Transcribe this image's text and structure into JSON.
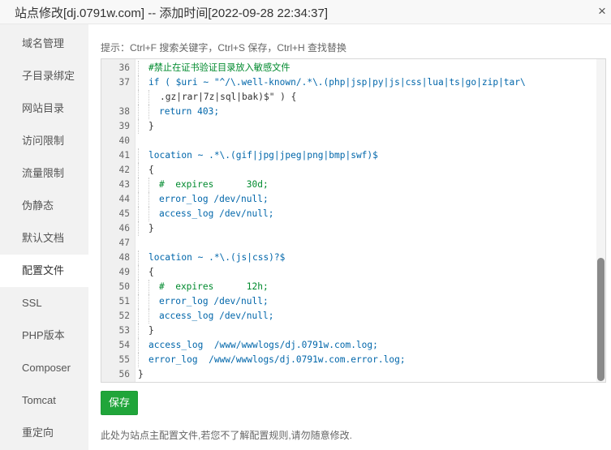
{
  "window": {
    "title": "站点修改[dj.0791w.com] -- 添加时间[2022-09-28 22:34:37]",
    "close_icon": "×"
  },
  "sidebar": {
    "items": [
      {
        "label": "域名管理"
      },
      {
        "label": "子目录绑定"
      },
      {
        "label": "网站目录"
      },
      {
        "label": "访问限制"
      },
      {
        "label": "流量限制"
      },
      {
        "label": "伪静态"
      },
      {
        "label": "默认文档"
      },
      {
        "label": "配置文件",
        "active": true
      },
      {
        "label": "SSL"
      },
      {
        "label": "PHP版本"
      },
      {
        "label": "Composer"
      },
      {
        "label": "Tomcat"
      },
      {
        "label": "重定向"
      }
    ]
  },
  "editor": {
    "hint": "提示：Ctrl+F 搜索关键字，Ctrl+S 保存，Ctrl+H 查找替换",
    "lines": [
      {
        "num": "36",
        "text": "#禁止在证书验证目录放入敏感文件"
      },
      {
        "num": "37",
        "text": "if ( $uri ~ \"^/\\.well-known/.*\\.(php|jsp|py|js|css|lua|ts|go|zip|tar\\"
      },
      {
        "num": "",
        "text": ".gz|rar|7z|sql|bak)$\" ) {"
      },
      {
        "num": "38",
        "text": "return 403;"
      },
      {
        "num": "39",
        "text": "}"
      },
      {
        "num": "40",
        "text": ""
      },
      {
        "num": "41",
        "text": "location ~ .*\\.(gif|jpg|jpeg|png|bmp|swf)$"
      },
      {
        "num": "42",
        "text": "{"
      },
      {
        "num": "43",
        "text": "#  expires      30d;"
      },
      {
        "num": "44",
        "text": "error_log /dev/null;"
      },
      {
        "num": "45",
        "text": "access_log /dev/null;"
      },
      {
        "num": "46",
        "text": "}"
      },
      {
        "num": "47",
        "text": ""
      },
      {
        "num": "48",
        "text": "location ~ .*\\.(js|css)?$"
      },
      {
        "num": "49",
        "text": "{"
      },
      {
        "num": "50",
        "text": "#  expires      12h;"
      },
      {
        "num": "51",
        "text": "error_log /dev/null;"
      },
      {
        "num": "52",
        "text": "access_log /dev/null;"
      },
      {
        "num": "53",
        "text": "}"
      },
      {
        "num": "54",
        "text": "access_log  /www/wwwlogs/dj.0791w.com.log;"
      },
      {
        "num": "55",
        "text": "error_log  /www/wwwlogs/dj.0791w.com.error.log;"
      },
      {
        "num": "56",
        "text": "}"
      }
    ]
  },
  "save_button": {
    "label": "保存"
  },
  "footer_note": "此处为站点主配置文件,若您不了解配置规则,请勿随意修改.",
  "colors": {
    "accent": "#20a53a",
    "keyword": "#0066aa",
    "comment": "#008a2e"
  }
}
